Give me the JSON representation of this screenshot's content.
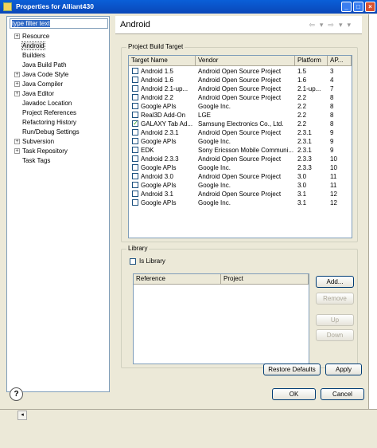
{
  "window": {
    "title": "Properties for Alliant430"
  },
  "filter": {
    "placeholder": "type filter text"
  },
  "tree": [
    {
      "label": "Resource",
      "expandable": true
    },
    {
      "label": "Android",
      "expandable": false,
      "selected": true
    },
    {
      "label": "Builders",
      "expandable": false
    },
    {
      "label": "Java Build Path",
      "expandable": false
    },
    {
      "label": "Java Code Style",
      "expandable": true
    },
    {
      "label": "Java Compiler",
      "expandable": true
    },
    {
      "label": "Java Editor",
      "expandable": true
    },
    {
      "label": "Javadoc Location",
      "expandable": false
    },
    {
      "label": "Project References",
      "expandable": false
    },
    {
      "label": "Refactoring History",
      "expandable": false
    },
    {
      "label": "Run/Debug Settings",
      "expandable": false
    },
    {
      "label": "Subversion",
      "expandable": true
    },
    {
      "label": "Task Repository",
      "expandable": true
    },
    {
      "label": "Task Tags",
      "expandable": false
    }
  ],
  "page": {
    "title": "Android"
  },
  "build_target": {
    "group_label": "Project Build Target",
    "columns": [
      "Target Name",
      "Vendor",
      "Platform",
      "AP..."
    ],
    "rows": [
      {
        "name": "Android 1.5",
        "vendor": "Android Open Source Project",
        "platform": "1.5",
        "api": "3",
        "checked": false
      },
      {
        "name": "Android 1.6",
        "vendor": "Android Open Source Project",
        "platform": "1.6",
        "api": "4",
        "checked": false
      },
      {
        "name": "Android 2.1-up...",
        "vendor": "Android Open Source Project",
        "platform": "2.1-up...",
        "api": "7",
        "checked": false
      },
      {
        "name": "Android 2.2",
        "vendor": "Android Open Source Project",
        "platform": "2.2",
        "api": "8",
        "checked": false
      },
      {
        "name": "Google APIs",
        "vendor": "Google Inc.",
        "platform": "2.2",
        "api": "8",
        "checked": false
      },
      {
        "name": "Real3D Add-On",
        "vendor": "LGE",
        "platform": "2.2",
        "api": "8",
        "checked": false
      },
      {
        "name": "GALAXY Tab Ad...",
        "vendor": "Samsung Electronics Co., Ltd.",
        "platform": "2.2",
        "api": "8",
        "checked": true
      },
      {
        "name": "Android 2.3.1",
        "vendor": "Android Open Source Project",
        "platform": "2.3.1",
        "api": "9",
        "checked": false
      },
      {
        "name": "Google APIs",
        "vendor": "Google Inc.",
        "platform": "2.3.1",
        "api": "9",
        "checked": false
      },
      {
        "name": "EDK",
        "vendor": "Sony Ericsson Mobile Communi...",
        "platform": "2.3.1",
        "api": "9",
        "checked": false
      },
      {
        "name": "Android 2.3.3",
        "vendor": "Android Open Source Project",
        "platform": "2.3.3",
        "api": "10",
        "checked": false
      },
      {
        "name": "Google APIs",
        "vendor": "Google Inc.",
        "platform": "2.3.3",
        "api": "10",
        "checked": false
      },
      {
        "name": "Android 3.0",
        "vendor": "Android Open Source Project",
        "platform": "3.0",
        "api": "11",
        "checked": false
      },
      {
        "name": "Google APIs",
        "vendor": "Google Inc.",
        "platform": "3.0",
        "api": "11",
        "checked": false
      },
      {
        "name": "Android 3.1",
        "vendor": "Android Open Source Project",
        "platform": "3.1",
        "api": "12",
        "checked": false
      },
      {
        "name": "Google APIs",
        "vendor": "Google Inc.",
        "platform": "3.1",
        "api": "12",
        "checked": false
      }
    ]
  },
  "library": {
    "group_label": "Library",
    "is_library_label": "Is Library",
    "columns": [
      "Reference",
      "Project"
    ],
    "buttons": {
      "add": "Add...",
      "remove": "Remove",
      "up": "Up",
      "down": "Down"
    }
  },
  "actions": {
    "restore_defaults": "Restore Defaults",
    "apply": "Apply",
    "ok": "OK",
    "cancel": "Cancel"
  },
  "icons": {
    "help": "?",
    "check": "✓",
    "collapsed": "+"
  }
}
